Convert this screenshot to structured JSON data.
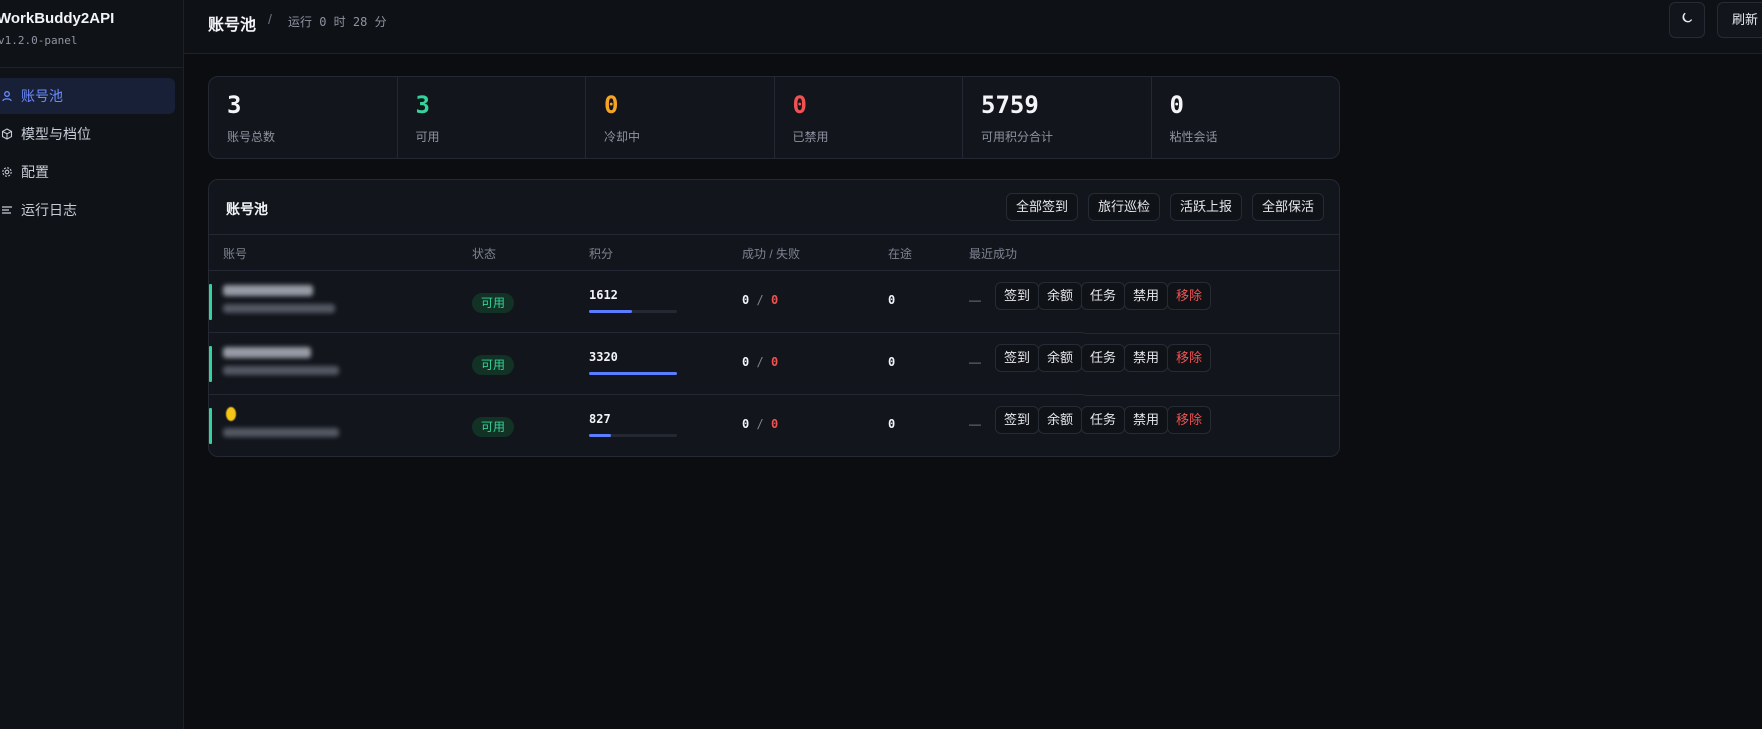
{
  "app": {
    "title": "WorkBuddy2API",
    "version": "v1.2.0-panel"
  },
  "sidebar": {
    "items": [
      {
        "label": "账号池",
        "icon": "user-icon",
        "active": true
      },
      {
        "label": "模型与档位",
        "icon": "cube-icon",
        "active": false
      },
      {
        "label": "配置",
        "icon": "gear-icon",
        "active": false
      },
      {
        "label": "运行日志",
        "icon": "list-icon",
        "active": false
      }
    ]
  },
  "header": {
    "title": "账号池",
    "separator": "/",
    "runtime": "运行 0 时 28 分",
    "theme_icon": "moon-icon",
    "refresh_label": "刷新"
  },
  "stats": [
    {
      "value": "3",
      "label": "账号总数",
      "color": "#f2f4f8"
    },
    {
      "value": "3",
      "label": "可用",
      "color": "#34d399"
    },
    {
      "value": "0",
      "label": "冷却中",
      "color": "#f5a524"
    },
    {
      "value": "0",
      "label": "已禁用",
      "color": "#f05252"
    },
    {
      "value": "5759",
      "label": "可用积分合计",
      "color": "#f2f4f8"
    },
    {
      "value": "0",
      "label": "粘性会话",
      "color": "#f2f4f8"
    }
  ],
  "pool": {
    "title": "账号池",
    "toolbar": [
      "全部签到",
      "旅行巡检",
      "活跃上报",
      "全部保活"
    ],
    "columns": [
      "账号",
      "状态",
      "积分",
      "成功 / 失败",
      "在途",
      "最近成功"
    ],
    "rows": [
      {
        "status": "可用",
        "points": "1612",
        "points_fraction": 0.49,
        "success": "0",
        "fail": "0",
        "inflight": "0",
        "last_success": "—"
      },
      {
        "status": "可用",
        "points": "3320",
        "points_fraction": 1.0,
        "success": "0",
        "fail": "0",
        "inflight": "0",
        "last_success": "—"
      },
      {
        "status": "可用",
        "points": "827",
        "points_fraction": 0.25,
        "success": "0",
        "fail": "0",
        "inflight": "0",
        "last_success": "—"
      }
    ],
    "row_actions": [
      "签到",
      "余额",
      "任务",
      "禁用",
      "移除"
    ],
    "sf_separator": "/"
  }
}
